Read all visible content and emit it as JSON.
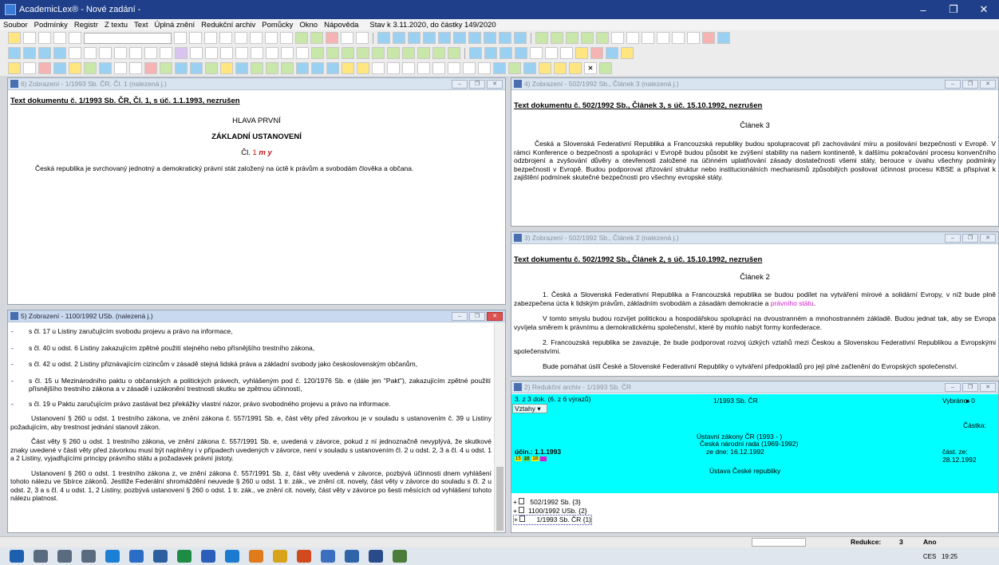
{
  "window": {
    "title": "AcademicLex® - Nové zadání -"
  },
  "menu": {
    "items": [
      "Soubor",
      "Podmínky",
      "Registr",
      "Z textu",
      "Text",
      "Úplná znění",
      "Redukční archiv",
      "Pomůcky",
      "Okno",
      "Nápověda"
    ],
    "status": "Stav k 3.11.2020, do částky 149/2020"
  },
  "win1": {
    "header": "6) Zobrazení - 1/1993 Sb. ČR, Čl. 1 (nalezená j.)",
    "doc_title": "Text dokumentu č. 1/1993 Sb. ČR, Čl. 1, s úč. 1.1.1993, nezrušen",
    "hlava": "HLAVA PRVNÍ",
    "zakladni": "ZÁKLADNÍ USTANOVENÍ",
    "cl_prefix": "Čl.",
    "cl_num": "1",
    "cl_suffix": "m y",
    "text": "Česká republika je svrchovaný jednotný a demokratický právní stát založený na úctě k právům a svobodám člověka a občana."
  },
  "win4": {
    "header": "4) Zobrazení - 502/1992 Sb., Článek 3 (nalezená j.)",
    "doc_title": "Text dokumentu č. 502/1992 Sb., Článek 3, s úč. 15.10.1992, nezrušen",
    "clanek": "Článek 3",
    "text": "Česká a Slovenská Federativní Republika a Francouzská republiky budou spolupracovat při zachovávání míru a posilování bezpečnosti v Evropě. V rámci Konference o bezpečnosti a spolupráci v Evropě budou působit ke zvýšení stability na našem kontinentě, k dalšímu pokračování procesu konvenčního odzbrojení a zvyšování důvěry a otevřenosti založené na účinném uplatňování zásady dostatečnosti všemi státy, berouce v úvahu všechny podmínky bezpečnosti v Evropě. Budou podporovat zřizování struktur nebo institucionálních mechanismů způsobilých posilovat účinnost procesu KBSE a přispívat k zajištění podmínek skutečné bezpečnosti pro všechny evropské státy."
  },
  "win3": {
    "header": "3) Zobrazení - 502/1992 Sb., Článek 2 (nalezená j.)",
    "doc_title": "Text dokumentu č. 502/1992 Sb., Článek 2, s úč. 15.10.1992, nezrušen",
    "clanek": "Článek 2",
    "p1_start": "1. Česká a Slovenská Federativní Republika a Francouzská republika se budou podílet na vytváření mírové a solidární Evropy, v níž bude plně zabezpečena úcta k lidským právům, základním svobodám a zásadám demokracie a ",
    "p1_link": "právního státu",
    "p1_end": ".",
    "p2": "V tomto smyslu budou rozvíjet politickou a hospodářskou spolupráci na dvoustranném a mnohostranném základě. Budou jednat tak, aby se Evropa vyvíjela směrem k právnímu a demokratickému společenství, které by mohlo nabýt formy konfederace.",
    "p3": "2. Francouzská republika se zavazuje, že bude podporovat rozvoj úzkých vztahů mezi Českou a Slovenskou Federativní Republikou a Evropskými společenstvími.",
    "p4": "Bude pomáhat úsilí České a Slovenské Federativní Republiky o vytváření předpokladů pro její plné začlenění do Evropských společenství."
  },
  "win5": {
    "header": "5) Zobrazení - 1100/1992 USb. (nalezená j.)",
    "lines": [
      "s čl. 17 u Listiny zaručujícím svobodu projevu a právo na informace,",
      "s čl. 40 u odst. 6 Listiny zakazujícím zpětné použití stejného nebo přísnějšího trestního zákona,",
      "s čl. 42 u odst. 2 Listiny přiznávajícím cizincům v zásadě stejná lidská práva a základní svobody jako československým občanům,",
      "s čl. 15 u Mezinárodního paktu o občanských a politických právech, vyhlášeným pod č. 120/1976 Sb. e (dále jen \"Pakt\"), zakazujícím zpětné použití přísnějšího trestního zákona a v zásadě i uzákonění trestnosti skutku se zpětnou účinností,",
      "s čl. 19 u Paktu zaručujícím právo zastávat bez překážky vlastní názor, právo svobodného projevu a právo na informace."
    ],
    "paras": [
      "Ustanovení § 260 u odst. 1 trestního zákona, ve znění zákona č. 557/1991 Sb. e, část věty před závorkou je v souladu s ustanovením č. 39 u Listiny požadujícím, aby trestnost jednání stanovil zákon.",
      "Část věty § 260 u odst. 1 trestního zákona, ve znění zákona č. 557/1991 Sb. e, uvedená v závorce, pokud z ní jednoznačně nevyplývá, že skutkové znaky uvedené v části věty před závorkou musí být naplněny i v případech uvedených v závorce, není v souladu s ustanovením čl. 2 u odst. 2, 3 a čl. 4 u odst. 1 a 2 Listiny, vyjadřujícími principy právního státu a požadavek právní jistoty.",
      "Ustanovení § 260 o odst. 1 trestního zákona z, ve znění zákona č. 557/1991 Sb. z, část věty uvedená v závorce, pozbývá účinnosti dnem vyhlášení tohoto nálezu ve Sbírce zákonů. Jestliže Federální shromáždění neuvede § 260 u odst. 1 tr. zák., ve znění cit. novely, část věty v závorce do souladu s čl. 2 u odst. 2, 3 a s čl. 4 u odst. 1, 2 Listiny, pozbývá ustanovení § 260 o odst. 1 tr. zák., ve znění cit. novely, část věty v závorce po šesti měsících od vyhlášení tohoto nálezu platnost."
    ]
  },
  "win2": {
    "header": "2) Redukční archiv - 1/1993 Sb. ČR",
    "count": "3. z 3 dok. (6. z 6 výrazů)",
    "doc": "1/1993 Sb. ČR",
    "vybrano": "Vybráno: 0",
    "select_label": "Vztahy",
    "castka": "Částka:",
    "ustavni": "Ústavní zákony ČR (1993 -   )",
    "rada": "Česká národní rada (1969-1992)",
    "ucin": "účin.: 1.1.1993",
    "ze_dne": "ze dne: 16.12.1992",
    "cast_ze": "část. ze: 28.12.1992",
    "badges": [
      "15",
      "18",
      "18",
      ""
    ],
    "nazev": "Ústava České republiky",
    "tree": [
      "502/1992 Sb. {3}",
      "1100/1992 USb. {2}",
      "1/1993 Sb. ČR {1}"
    ]
  },
  "statusbar": {
    "redukce_label": "Redukce:",
    "redukce_value": "3",
    "ano": "Ano"
  },
  "taskbar": {
    "lang": "CES",
    "time": "19:25"
  }
}
